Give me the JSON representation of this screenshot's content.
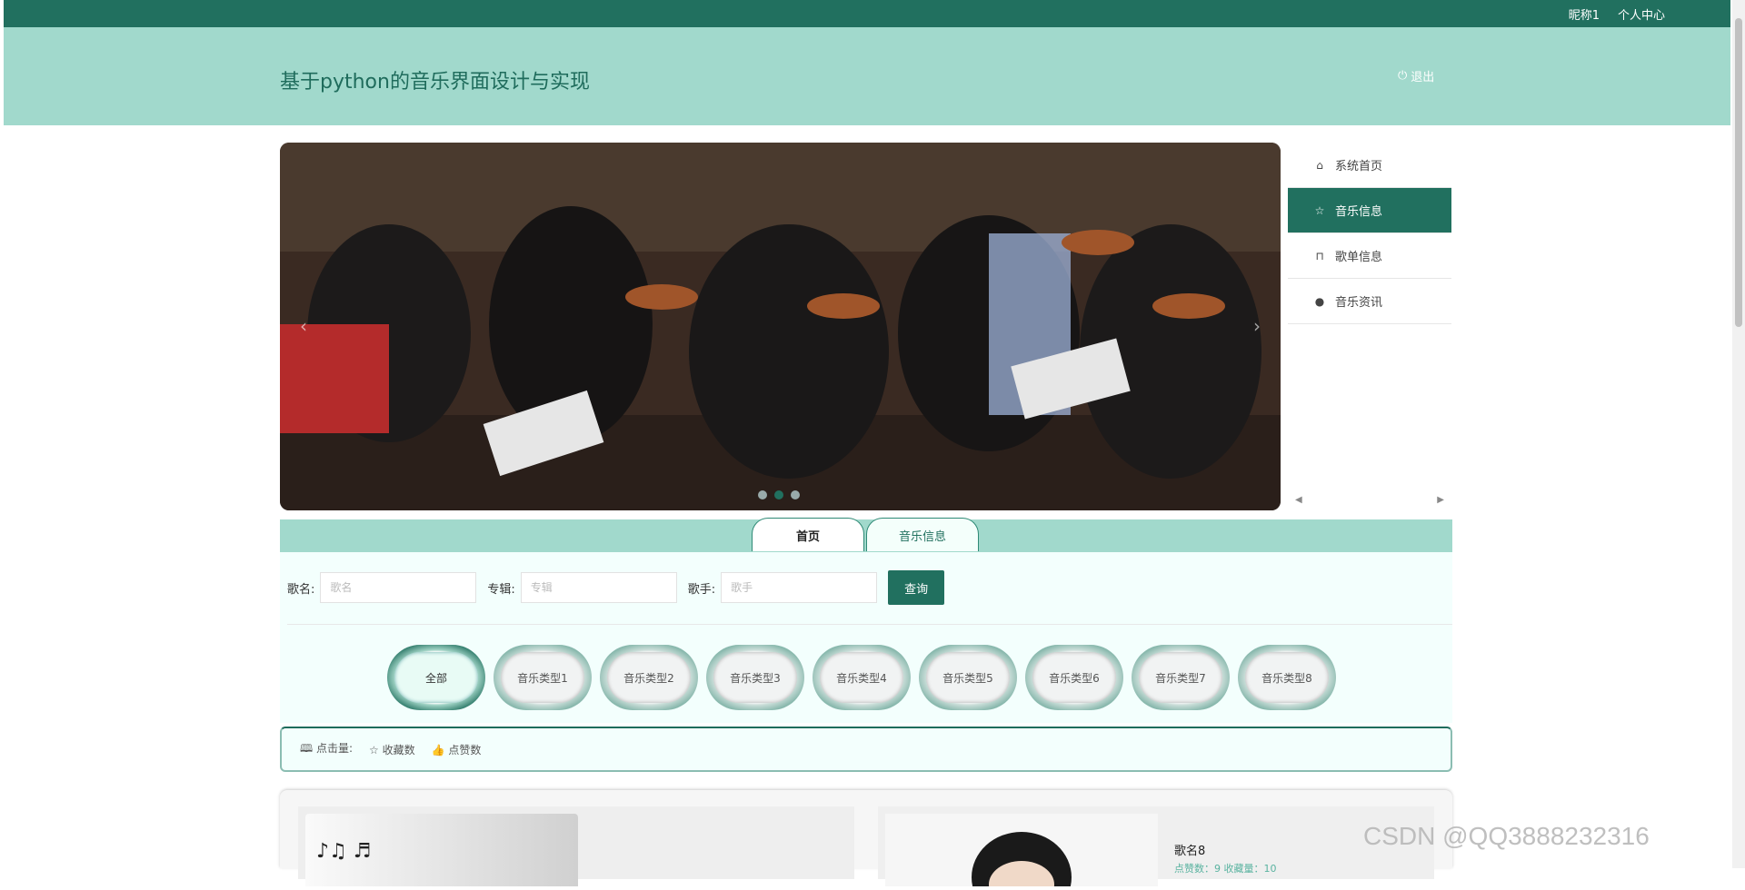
{
  "topbar": {
    "nickname": "昵称1",
    "profile": "个人中心"
  },
  "header": {
    "title": "基于python的音乐界面设计与实现",
    "logout": "退出"
  },
  "menu": {
    "items": [
      {
        "label": "系统首页",
        "icon": "home-icon"
      },
      {
        "label": "音乐信息",
        "icon": "star-icon"
      },
      {
        "label": "歌单信息",
        "icon": "bag-icon"
      },
      {
        "label": "音乐资讯",
        "icon": "info-icon"
      }
    ],
    "active_index": 1
  },
  "slider": {
    "active_dot": 1,
    "dot_count": 3
  },
  "tabs": {
    "home": "首页",
    "music": "音乐信息"
  },
  "search": {
    "song_label": "歌名:",
    "song_placeholder": "歌名",
    "album_label": "专辑:",
    "album_placeholder": "专辑",
    "singer_label": "歌手:",
    "singer_placeholder": "歌手",
    "query": "查询"
  },
  "categories": [
    "全部",
    "音乐类型1",
    "音乐类型2",
    "音乐类型3",
    "音乐类型4",
    "音乐类型5",
    "音乐类型6",
    "音乐类型7",
    "音乐类型8"
  ],
  "sort": {
    "clicks": "点击量:",
    "favorites": "收藏数",
    "likes": "点赞数"
  },
  "cards": [
    {
      "name": ""
    },
    {
      "name": "歌名8",
      "stats": "点赞数：9 收藏量：10"
    }
  ],
  "watermark": "CSDN @QQ3888232316",
  "colors": {
    "primary": "#21705f",
    "header_bg": "#a1d9cc",
    "panel_bg": "#f3fffd"
  }
}
